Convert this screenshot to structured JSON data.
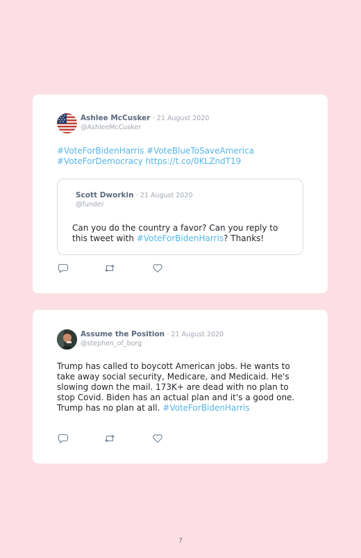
{
  "tweets": [
    {
      "author": "Ashlee McCusker",
      "date": "· 21 August 2020",
      "handle": "@AshleeMcCusker",
      "links_line1": "#VoteForBidenHarris #VoteBlueToSaveAmerica",
      "links_line2": "#VoteForDemocracy https://t.co/0KLZndT19",
      "quoted": {
        "author": "Scott Dworkin",
        "date": "· 21 August 2020",
        "handle": "@funder",
        "text_before": "Can you do the country a favor? Can you reply to this tweet with ",
        "hashtag": "#VoteForBidenHarris",
        "text_after": "? Thanks!"
      },
      "actions": [
        "reply-icon",
        "retweet-icon",
        "like-icon"
      ]
    },
    {
      "author": "Assume the Position",
      "date": "· 21 August 2020",
      "handle": "@stephen_of_borg",
      "text": "Trump has called to boycott American jobs. He wants to take away social security, Medicare, and Medicaid. He's slowing down the mail. 173K+ are dead with no plan to stop Covid. Biden has an actual plan and it's a good one. Trump has no plan at all. ",
      "hashtag": "#VoteForBidenHarris",
      "actions": [
        "reply-icon",
        "retweet-icon",
        "like-icon"
      ]
    }
  ],
  "page_number": "7",
  "colors": {
    "background": "#fcdfe4",
    "card": "#ffffff",
    "link": "#55b6e8",
    "author": "#5a6a7c",
    "muted": "#a0a7b0"
  }
}
